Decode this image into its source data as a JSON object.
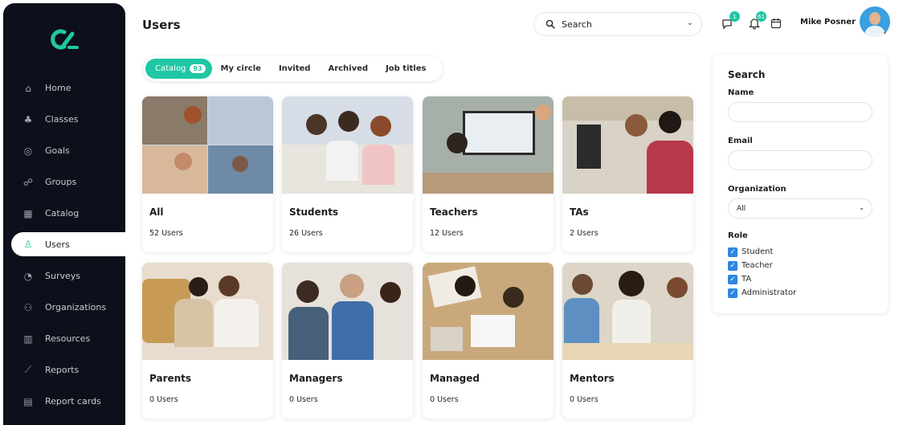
{
  "sidebar": {
    "logo": "logo-mark",
    "items": [
      {
        "label": "Home",
        "icon": "home-icon",
        "glyph": "⌂"
      },
      {
        "label": "Classes",
        "icon": "classes-icon",
        "glyph": "♣"
      },
      {
        "label": "Goals",
        "icon": "goals-icon",
        "glyph": "◎"
      },
      {
        "label": "Groups",
        "icon": "groups-icon",
        "glyph": "☍"
      },
      {
        "label": "Catalog",
        "icon": "catalog-icon",
        "glyph": "▦"
      },
      {
        "label": "Users",
        "icon": "users-icon",
        "glyph": "♙"
      },
      {
        "label": "Surveys",
        "icon": "surveys-icon",
        "glyph": "◔"
      },
      {
        "label": "Organizations",
        "icon": "organizations-icon",
        "glyph": "⚇"
      },
      {
        "label": "Resources",
        "icon": "resources-icon",
        "glyph": "▥"
      },
      {
        "label": "Reports",
        "icon": "reports-icon",
        "glyph": "⟋"
      },
      {
        "label": "Report cards",
        "icon": "report-cards-icon",
        "glyph": "▤"
      }
    ],
    "active_index": 5
  },
  "header": {
    "title": "Users",
    "search_label": "Search",
    "notifications": [
      {
        "icon": "messages-icon",
        "count": "1"
      },
      {
        "icon": "bell-icon",
        "count": "61"
      },
      {
        "icon": "calendar-icon",
        "count": ""
      }
    ],
    "user_name": "Mike Posner"
  },
  "tabs": [
    {
      "label": "Catalog",
      "count": "93"
    },
    {
      "label": "My circle"
    },
    {
      "label": "Invited"
    },
    {
      "label": "Archived"
    },
    {
      "label": "Job titles"
    }
  ],
  "cards": [
    {
      "name": "All",
      "count": "52 Users"
    },
    {
      "name": "Students",
      "count": "26 Users"
    },
    {
      "name": "Teachers",
      "count": "12 Users"
    },
    {
      "name": "TAs",
      "count": "2 Users"
    },
    {
      "name": "Parents",
      "count": "0 Users"
    },
    {
      "name": "Managers",
      "count": "0 Users"
    },
    {
      "name": "Managed",
      "count": "0 Users"
    },
    {
      "name": "Mentors",
      "count": "0 Users"
    }
  ],
  "filter": {
    "title": "Search",
    "name_label": "Name",
    "email_label": "Email",
    "org_label": "Organization",
    "org_value": "All",
    "role_label": "Role",
    "roles": [
      "Student",
      "Teacher",
      "TA",
      "Administrator"
    ]
  },
  "colors": {
    "accent": "#1fc7a4",
    "sidebar_bg": "#0d0f1a",
    "checkbox": "#2e86de"
  }
}
